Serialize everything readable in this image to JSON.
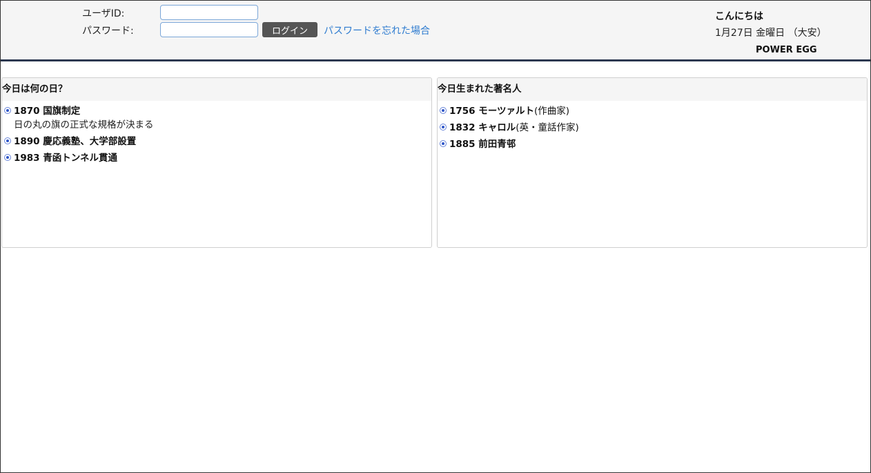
{
  "login": {
    "user_id_label": "ユーザID:",
    "password_label": "パスワード:",
    "user_id_value": "",
    "password_value": "",
    "login_button": "ログイン",
    "forgot_link": "パスワードを忘れた場合"
  },
  "header": {
    "greeting": "こんにちは",
    "date": "1月27日 金曜日 （大安）",
    "brand": "POWER EGG"
  },
  "panels": {
    "today": {
      "title": "今日は何の日？",
      "items": [
        {
          "title": "1870 国旗制定",
          "desc": "日の丸の旗の正式な規格が決まる"
        },
        {
          "title": "1890 慶応義塾、大学部設置"
        },
        {
          "title": "1983 青函トンネル貫通"
        }
      ]
    },
    "famous": {
      "title": "今日生まれた著名人",
      "items": [
        {
          "title": "1756 モーツァルト",
          "note": "(作曲家)"
        },
        {
          "title": "1832 キャロル",
          "note": "(英・童話作家)"
        },
        {
          "title": "1885 前田青邨"
        }
      ]
    }
  },
  "colors": {
    "header_border": "#2c3850",
    "link": "#2f7cd0",
    "bullet": "#2e55c8"
  }
}
